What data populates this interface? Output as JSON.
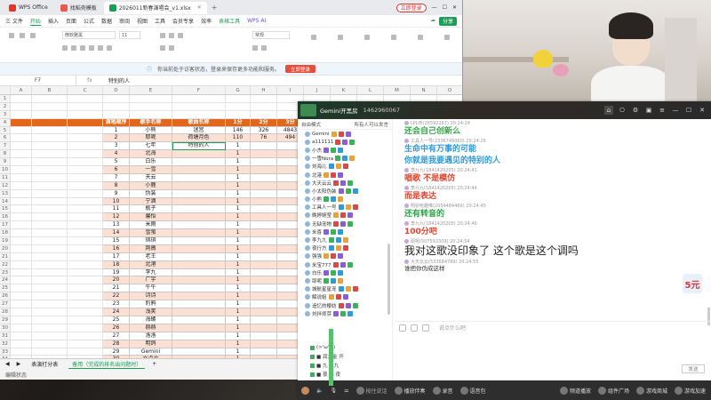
{
  "wps": {
    "tabs": [
      {
        "label": "WPS Office",
        "color": "#d93a2b"
      },
      {
        "label": "找稻壳模板",
        "color": "#e85a4f"
      },
      {
        "label": "2026011新春演唱会_v1.xlsx",
        "color": "#1e9d57",
        "active": true
      }
    ],
    "login": "立即登录",
    "menu": [
      "三 文件",
      "开始",
      "插入",
      "页面",
      "公式",
      "数据",
      "审阅",
      "视图",
      "工具",
      "会员专享",
      "效率",
      "表格工具",
      "WPS AI"
    ],
    "menu_active": "开始",
    "share": "分享",
    "ribbon": {
      "font_name": "微软雅黑",
      "font_size": "11",
      "format": "常规"
    },
    "notice": {
      "text": "你当前处于访客状态，登录来保存更多功能和服务。",
      "button": "立即登录"
    },
    "namebox": "F7",
    "fx": "fx",
    "formula": "特别的人",
    "columns": [
      "A",
      "B",
      "C",
      "D",
      "E",
      "F",
      "G",
      "H",
      "I",
      "J",
      "K",
      "L",
      "M",
      "N",
      "O"
    ],
    "headers": [
      "演唱顺序",
      "歌手名称",
      "歌曲名称",
      "1分",
      "2分",
      "3分",
      "4分"
    ],
    "rows": [
      {
        "n": "5",
        "d": "1",
        "e": "小熊",
        "f": "迷宫",
        "g": "146",
        "h": "326",
        "i": "4843",
        "j": "8640"
      },
      {
        "n": "6",
        "d": "2",
        "e": "耶呢",
        "f": "荷塘月色",
        "g": "110",
        "h": "76",
        "i": "494",
        "j": "4759"
      },
      {
        "n": "7",
        "d": "3",
        "e": "七年",
        "f": "特别的人",
        "g": "1",
        "h": "",
        "i": "",
        "j": ""
      },
      {
        "n": "8",
        "d": "4",
        "e": "北海",
        "f": "",
        "g": "1",
        "h": "",
        "i": "",
        "j": ""
      },
      {
        "n": "9",
        "d": "5",
        "e": "白乐",
        "f": "",
        "g": "1",
        "h": "",
        "i": "",
        "j": ""
      },
      {
        "n": "10",
        "d": "6",
        "e": "一雪",
        "f": "",
        "g": "1",
        "h": "",
        "i": "",
        "j": ""
      },
      {
        "n": "11",
        "d": "7",
        "e": "天云",
        "f": "",
        "g": "1",
        "h": "",
        "i": "",
        "j": ""
      },
      {
        "n": "12",
        "d": "8",
        "e": "小鹿",
        "f": "",
        "g": "1",
        "h": "",
        "i": "",
        "j": ""
      },
      {
        "n": "13",
        "d": "9",
        "e": "伪装",
        "f": "",
        "g": "1",
        "h": "",
        "i": "",
        "j": ""
      },
      {
        "n": "14",
        "d": "10",
        "e": "宁酒",
        "f": "",
        "g": "1",
        "h": "",
        "i": "",
        "j": ""
      },
      {
        "n": "15",
        "d": "11",
        "e": "瓶子",
        "f": "",
        "g": "1",
        "h": "",
        "i": "",
        "j": ""
      },
      {
        "n": "16",
        "d": "12",
        "e": "馨怡",
        "f": "",
        "g": "1",
        "h": "",
        "i": "",
        "j": ""
      },
      {
        "n": "17",
        "d": "13",
        "e": "米雨",
        "f": "",
        "g": "1",
        "h": "",
        "i": "",
        "j": ""
      },
      {
        "n": "18",
        "d": "14",
        "e": "雪萤",
        "f": "",
        "g": "1",
        "h": "",
        "i": "",
        "j": ""
      },
      {
        "n": "19",
        "d": "15",
        "e": "琪琪",
        "f": "",
        "g": "1",
        "h": "",
        "i": "",
        "j": ""
      },
      {
        "n": "20",
        "d": "16",
        "e": "荆薇",
        "f": "",
        "g": "1",
        "h": "",
        "i": "",
        "j": ""
      },
      {
        "n": "21",
        "d": "17",
        "e": "老王",
        "f": "",
        "g": "1",
        "h": "",
        "i": "",
        "j": ""
      },
      {
        "n": "22",
        "d": "18",
        "e": "北港",
        "f": "",
        "g": "1",
        "h": "",
        "i": "",
        "j": ""
      },
      {
        "n": "23",
        "d": "19",
        "e": "李九",
        "f": "",
        "g": "1",
        "h": "",
        "i": "",
        "j": ""
      },
      {
        "n": "24",
        "d": "20",
        "e": "广宇",
        "f": "",
        "g": "1",
        "h": "",
        "i": "",
        "j": ""
      },
      {
        "n": "25",
        "d": "21",
        "e": "牛牛",
        "f": "",
        "g": "1",
        "h": "",
        "i": "",
        "j": ""
      },
      {
        "n": "26",
        "d": "22",
        "e": "诗诗",
        "f": "",
        "g": "1",
        "h": "",
        "i": "",
        "j": ""
      },
      {
        "n": "27",
        "d": "23",
        "e": "豹鸦",
        "f": "",
        "g": "1",
        "h": "",
        "i": "",
        "j": ""
      },
      {
        "n": "28",
        "d": "24",
        "e": "浅笑",
        "f": "",
        "g": "1",
        "h": "",
        "i": "",
        "j": ""
      },
      {
        "n": "29",
        "d": "25",
        "e": "海螺",
        "f": "",
        "g": "1",
        "h": "",
        "i": "",
        "j": ""
      },
      {
        "n": "30",
        "d": "26",
        "e": "赫赫",
        "f": "",
        "g": "1",
        "h": "",
        "i": "",
        "j": ""
      },
      {
        "n": "31",
        "d": "27",
        "e": "洛洛",
        "f": "",
        "g": "1",
        "h": "",
        "i": "",
        "j": ""
      },
      {
        "n": "32",
        "d": "28",
        "e": "明鸽",
        "f": "",
        "g": "1",
        "h": "",
        "i": "",
        "j": ""
      },
      {
        "n": "33",
        "d": "29",
        "e": "Gemini",
        "f": "",
        "g": "1",
        "h": "",
        "i": "",
        "j": ""
      },
      {
        "n": "34",
        "d": "30",
        "e": "六点六",
        "f": "",
        "g": "1",
        "h": "",
        "i": "",
        "j": ""
      },
      {
        "n": "35",
        "d": "31",
        "e": "漂洒",
        "f": "",
        "g": "1",
        "h": "",
        "i": "",
        "j": ""
      }
    ],
    "sheet_tabs": [
      "表演打分表",
      "备用（完成的排名出问题时）"
    ],
    "sheet_active": "备用（完成的排名出问题时）",
    "status": "编辑状态"
  },
  "chat": {
    "room_name": "Gemini开黑房",
    "room_id": "1462960067",
    "list_mode": "自由模式",
    "list_right": "所有人可以发言",
    "users": [
      "Gemini",
      "a111111",
      "小杰",
      "一雪Nora",
      "刘海儿",
      "北港",
      "大天云云",
      "小太阳伪装",
      "小熊",
      "工具人一号",
      "晚婷婉莹",
      "无缺宠物",
      "米喜",
      "李九九",
      "夜行方",
      "强强",
      "米宝777",
      "白乐",
      "耶呢",
      "城航星星宠",
      "解说姐",
      "追忆的樱妨",
      "刘拌烦芽"
    ],
    "sections": [
      "(>'ω'<)",
      "■ 润力金 开",
      "■ 九 生九",
      "■ 夜 鸟 夜",
      "■ 黑 童 奥 港"
    ],
    "messages": [
      {
        "meta": "LPL传(26592267)  20:24:24",
        "text": "还会自己创新么",
        "color": "#3aa84b",
        "style": ""
      },
      {
        "meta": "工具人一号(2336749060)  20:24:26",
        "text": "生命中有万事的可能",
        "color": "#2f9ad6",
        "style": ""
      },
      {
        "meta": "",
        "text": "你就是我要遇见的特别的人",
        "color": "#2f9ad6",
        "style": ""
      },
      {
        "meta": "李九九(1841420205)  20:24:41",
        "text": "唱歌 不是模仿",
        "color": "#e0442e",
        "style": ""
      },
      {
        "meta": "李九九(1841420205)  20:24:44",
        "text": "而是表达",
        "color": "#e0442e",
        "style": ""
      },
      {
        "meta": "明钞哈趣唯(2054484466)  20:24:45",
        "text": "还有转音的",
        "color": "#2fa24a",
        "style": ""
      },
      {
        "meta": "李九九(1841420205)  20:24:46",
        "text": "100分吧",
        "color": "#e0442e",
        "style": ""
      },
      {
        "meta": "耶呢(507593309)  20:24:54",
        "text": "我对这歌没印象了  这个歌是这个调吗",
        "color": "#222",
        "style": "big"
      },
      {
        "meta": "大天云云(533684789)  20:24:55",
        "text": "谁把你伪成这样",
        "color": "#333",
        "style": "sm"
      }
    ],
    "badge": "5元",
    "input_placeholder": "说点什么吧",
    "send": "发送",
    "bottom": [
      "按住说话",
      "播放伴奏",
      "录音",
      "语音包"
    ],
    "bottom_right": [
      "频道播放",
      "组件广场",
      "游戏商城",
      "游戏加速"
    ]
  }
}
